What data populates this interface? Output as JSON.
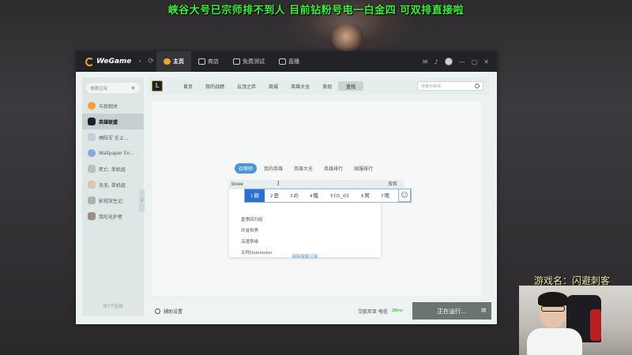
{
  "overlay": {
    "stream_title": "峡谷大号已宗师排不到人 目前钻粉号电一白金四 可双排直接啦",
    "streamer_name": "游戏名：闪避刺客"
  },
  "topbar": {
    "logo": "WeGame",
    "back": "‹",
    "refresh": "⟳",
    "tabs": [
      {
        "label": "主页",
        "active": true
      },
      {
        "label": "商店",
        "active": false
      },
      {
        "label": "免费测试",
        "active": false
      },
      {
        "label": "直播",
        "active": false
      }
    ],
    "window_controls": [
      "—",
      "▢",
      "✕"
    ]
  },
  "sidebar": {
    "search_placeholder": "搜索应用",
    "add": "+",
    "items": [
      {
        "label": "与我相关",
        "active": false
      },
      {
        "label": "英雄联盟",
        "active": true
      },
      {
        "label": "绳陆军 在上...",
        "active": false
      },
      {
        "label": "Wallpaper En...",
        "active": false
      },
      {
        "label": "死亡, 单机组",
        "active": false
      },
      {
        "label": "无无, 单机组",
        "active": false
      },
      {
        "label": "影视深生记",
        "active": false
      },
      {
        "label": "我吃化护者",
        "active": false
      }
    ],
    "footer": "共7个应用",
    "collapse": "‹"
  },
  "gamehead": {
    "icon": "L",
    "tabs": [
      {
        "label": "首页",
        "active": false
      },
      {
        "label": "我的战绩",
        "active": false
      },
      {
        "label": "云顶之弈",
        "active": false
      },
      {
        "label": "商城",
        "active": false
      },
      {
        "label": "英雄大全",
        "active": false
      },
      {
        "label": "发现",
        "active": false
      },
      {
        "label": "查找",
        "active": true
      }
    ],
    "search_placeholder": "搜索召唤师"
  },
  "panel": {
    "subtabs": [
      {
        "label": "召唤师",
        "active": true
      },
      {
        "label": "我的英雄",
        "active": false
      },
      {
        "label": "英雄大全",
        "active": false
      },
      {
        "label": "英雄排行",
        "active": false
      },
      {
        "label": "国服排行",
        "active": false
      }
    ],
    "search_value": "boee",
    "search_button": "搜索",
    "history": [
      "夏季回归组",
      "环游世界",
      "深渡孽缘",
      "天秤Dolorestor"
    ],
    "clear_history": "清除搜索记录"
  },
  "ime": {
    "candidates": [
      {
        "n": "1",
        "text": "额",
        "active": true
      },
      {
        "n": "2",
        "text": "恶",
        "active": false
      },
      {
        "n": "3",
        "text": "の",
        "active": false
      },
      {
        "n": "4",
        "text": "俄",
        "active": false
      },
      {
        "n": "5",
        "text": "(⊙_⊙)",
        "active": false
      },
      {
        "n": "6",
        "text": "阿",
        "active": false
      },
      {
        "n": "7",
        "text": "呃",
        "active": false
      }
    ],
    "emoji": "☺"
  },
  "bottombar": {
    "assist": "辅助设置",
    "game_name": "艾欧尼亚 电信",
    "latency": "28ms",
    "up_arrow": "⇧",
    "running": "正在运行...",
    "menu": "≡"
  }
}
